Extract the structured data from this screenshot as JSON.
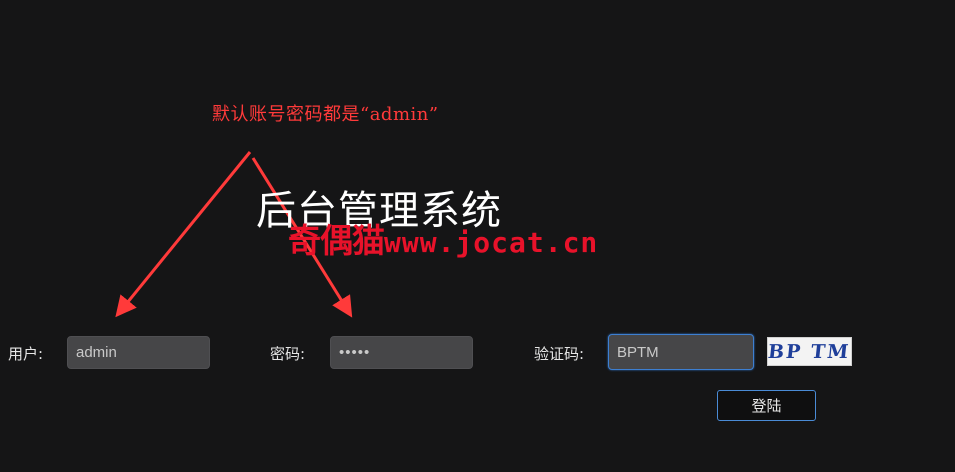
{
  "annotation": {
    "text": "默认账号密码都是“admin”",
    "color": "#ff3a3a"
  },
  "header": {
    "title": "后台管理系统"
  },
  "watermark": {
    "cn": "奇偶猫",
    "url": "www.jocat.cn",
    "color": "#e8122a"
  },
  "form": {
    "username": {
      "label": "用户:",
      "value": "admin"
    },
    "password": {
      "label": "密码:",
      "value": "admin"
    },
    "captcha": {
      "label": "验证码:",
      "value": "BPTM",
      "image_text": "BP TM"
    },
    "submit_label": "登陆"
  },
  "colors": {
    "background": "#151516",
    "input_bg": "#464648",
    "focus_border": "#3d7fd1",
    "button_border": "#4a8bd6"
  }
}
